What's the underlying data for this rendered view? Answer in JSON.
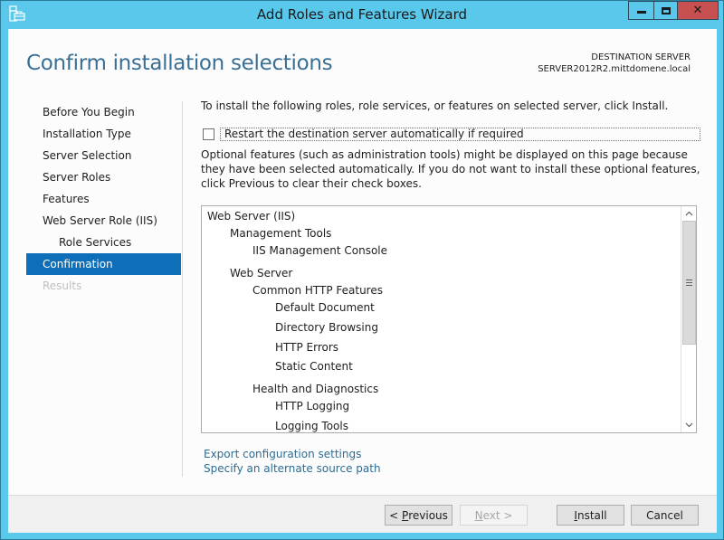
{
  "window": {
    "title": "Add Roles and Features Wizard",
    "icon": "server-manager-icon",
    "controls": {
      "minimize": "minimize-icon",
      "maximize": "maximize-icon",
      "close": "✕"
    }
  },
  "header": {
    "page_title": "Confirm installation selections",
    "destination_label": "DESTINATION SERVER",
    "destination_server": "SERVER2012R2.mittdomene.local"
  },
  "sidebar": {
    "items": [
      {
        "label": "Before You Begin",
        "state": "normal"
      },
      {
        "label": "Installation Type",
        "state": "normal"
      },
      {
        "label": "Server Selection",
        "state": "normal"
      },
      {
        "label": "Server Roles",
        "state": "normal"
      },
      {
        "label": "Features",
        "state": "normal"
      },
      {
        "label": "Web Server Role (IIS)",
        "state": "normal"
      },
      {
        "label": "Role Services",
        "state": "sub"
      },
      {
        "label": "Confirmation",
        "state": "active"
      },
      {
        "label": "Results",
        "state": "disabled"
      }
    ]
  },
  "main": {
    "intro": "To install the following roles, role services, or features on selected server, click Install.",
    "restart_checkbox": {
      "label": "Restart the destination server automatically if required",
      "checked": false
    },
    "optional_note": "Optional features (such as administration tools) might be displayed on this page because they have been selected automatically. If you do not want to install these optional features, click Previous to clear their check boxes.",
    "selections": [
      {
        "label": "Web Server (IIS)",
        "level": 0
      },
      {
        "label": "Management Tools",
        "level": 1
      },
      {
        "label": "IIS Management Console",
        "level": 2
      },
      {
        "label": "Web Server",
        "level": 1
      },
      {
        "label": "Common HTTP Features",
        "level": 2
      },
      {
        "label": "Default Document",
        "level": 3
      },
      {
        "label": "Directory Browsing",
        "level": 3
      },
      {
        "label": "HTTP Errors",
        "level": 3
      },
      {
        "label": "Static Content",
        "level": 3
      },
      {
        "label": "Health and Diagnostics",
        "level": 2
      },
      {
        "label": "HTTP Logging",
        "level": 3
      },
      {
        "label": "Logging Tools",
        "level": 3
      }
    ],
    "links": {
      "export": "Export configuration settings",
      "alternate_source": "Specify an alternate source path"
    }
  },
  "footer": {
    "previous": {
      "prefix": "< ",
      "mnemonic": "P",
      "rest": "revious",
      "enabled": true
    },
    "next": {
      "mnemonic": "N",
      "rest": "ext >",
      "enabled": false
    },
    "install": {
      "mnemonic": "I",
      "rest": "nstall",
      "enabled": true
    },
    "cancel": {
      "label": "Cancel",
      "enabled": true
    }
  },
  "colors": {
    "frame": "#5ac8eb",
    "accent": "#0e6fb8",
    "title_text": "#3a6f95",
    "link": "#2e6c92",
    "close_button": "#c75050"
  }
}
